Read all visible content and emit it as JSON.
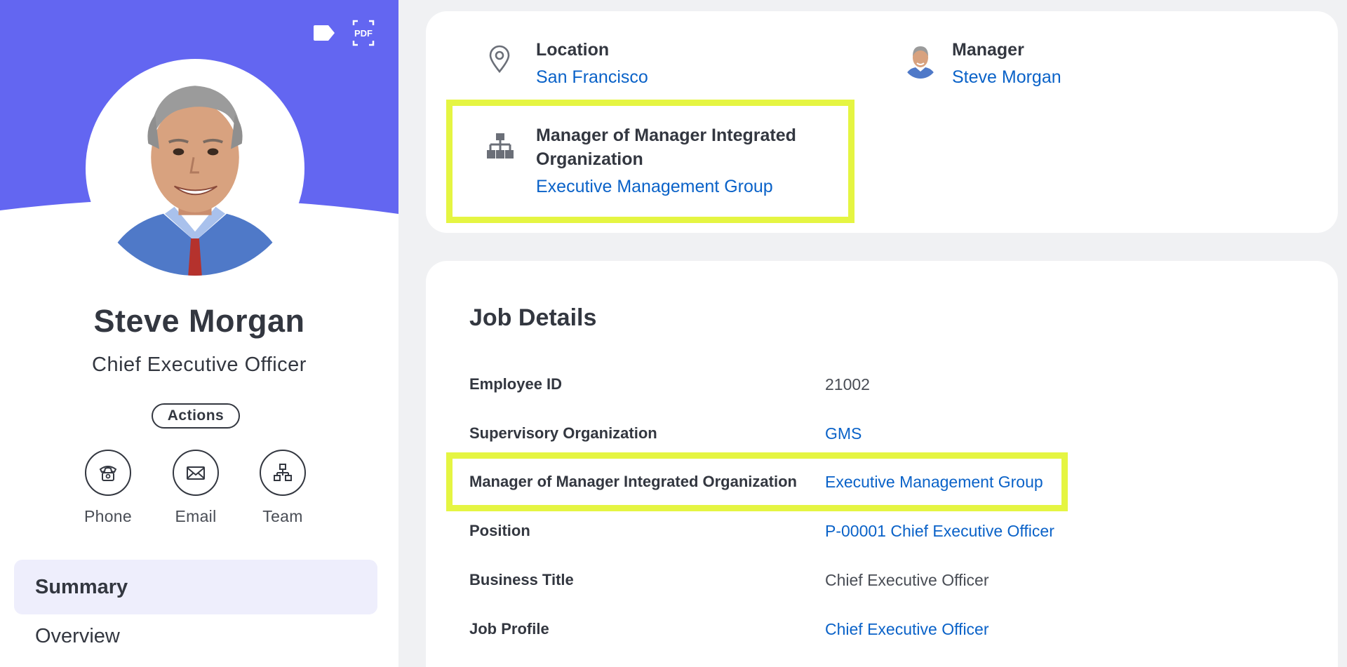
{
  "header": {
    "tag_icon": "tag-icon",
    "pdf_icon": "pdf-icon",
    "pdf_label": "PDF"
  },
  "profile": {
    "name": "Steve Morgan",
    "title": "Chief Executive Officer",
    "actions_label": "Actions",
    "avatar_icon": "avatar"
  },
  "quick_actions": [
    {
      "label": "Phone",
      "icon": "phone-icon"
    },
    {
      "label": "Email",
      "icon": "email-icon"
    },
    {
      "label": "Team",
      "icon": "team-icon"
    }
  ],
  "nav": {
    "summary": "Summary",
    "overview": "Overview"
  },
  "info_card": {
    "location": {
      "label": "Location",
      "value": "San Francisco",
      "icon": "location-pin-icon"
    },
    "manager": {
      "label": "Manager",
      "value": "Steve Morgan",
      "icon": "manager-avatar"
    },
    "mmio": {
      "label": "Manager of Manager Integrated Organization",
      "value": "Executive Management Group",
      "icon": "org-chart-icon"
    }
  },
  "job_details": {
    "title": "Job Details",
    "rows": [
      {
        "label": "Employee ID",
        "value": "21002",
        "link": false
      },
      {
        "label": "Supervisory Organization",
        "value": "GMS",
        "link": true
      },
      {
        "label": "Manager of Manager Integrated Organization",
        "value": "Executive Management Group",
        "link": true
      },
      {
        "label": "Position",
        "value": "P-00001 Chief Executive Officer",
        "link": true
      },
      {
        "label": "Business Title",
        "value": "Chief Executive Officer",
        "link": false
      },
      {
        "label": "Job Profile",
        "value": "Chief Executive Officer",
        "link": true
      }
    ]
  },
  "colors": {
    "banner": "#6366f1",
    "link": "#0a62c8",
    "highlight": "#e5f542",
    "text": "#333740",
    "nav_active_bg": "#eeeefc",
    "page_bg": "#f0f1f3"
  }
}
